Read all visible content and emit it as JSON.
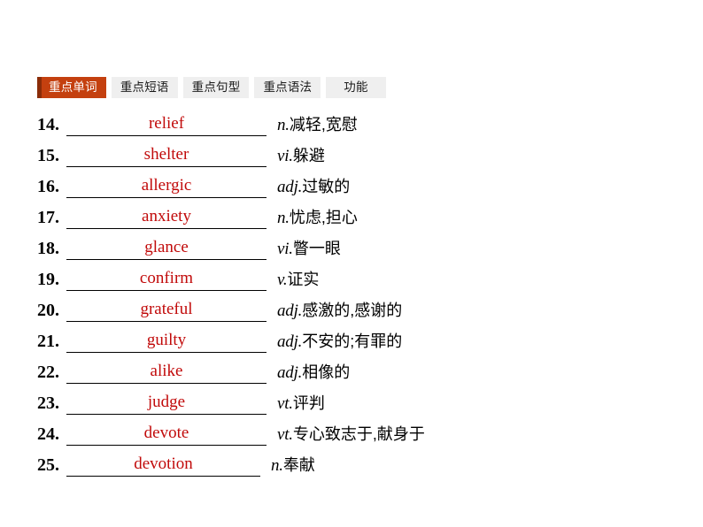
{
  "tabs": [
    {
      "label": "重点单词",
      "active": true,
      "wide": false
    },
    {
      "label": "重点短语",
      "active": false,
      "wide": false
    },
    {
      "label": "重点句型",
      "active": false,
      "wide": false
    },
    {
      "label": "重点语法",
      "active": false,
      "wide": false
    },
    {
      "label": "功能",
      "active": false,
      "wide": true
    }
  ],
  "colors": {
    "active_tab_bg": "#c4400f",
    "active_tab_accent": "#8a2c08",
    "active_tab_text": "#ffffff",
    "inactive_tab_bg": "#efefef",
    "answer_text": "#c10a0a",
    "page_bg": "#ffffff"
  },
  "words": [
    {
      "num": "14.",
      "answer": "relief",
      "pos": "n.",
      "cn": "减轻,宽慰"
    },
    {
      "num": "15.",
      "answer": "shelter",
      "pos": "vi.",
      "cn": "躲避"
    },
    {
      "num": "16.",
      "answer": "allergic",
      "pos": "adj.",
      "cn": "过敏的"
    },
    {
      "num": "17.",
      "answer": "anxiety",
      "pos": "n.",
      "cn": "忧虑,担心"
    },
    {
      "num": "18.",
      "answer": "glance",
      "pos": "vi.",
      "cn": "瞥一眼"
    },
    {
      "num": "19.",
      "answer": "confirm",
      "pos": "v.",
      "cn": "证实"
    },
    {
      "num": "20.",
      "answer": "grateful",
      "pos": "adj.",
      "cn": "感激的,感谢的"
    },
    {
      "num": "21.",
      "answer": "guilty",
      "pos": "adj.",
      "cn": "不安的;有罪的"
    },
    {
      "num": "22.",
      "answer": "alike",
      "pos": "adj.",
      "cn": "相像的"
    },
    {
      "num": "23.",
      "answer": "judge",
      "pos": "vt.",
      "cn": "评判"
    },
    {
      "num": "24.",
      "answer": "devote",
      "pos": "vt.",
      "cn": "专心致志于,献身于"
    },
    {
      "num": "25.",
      "answer": "devotion",
      "pos": "n.",
      "cn": "奉献"
    }
  ]
}
